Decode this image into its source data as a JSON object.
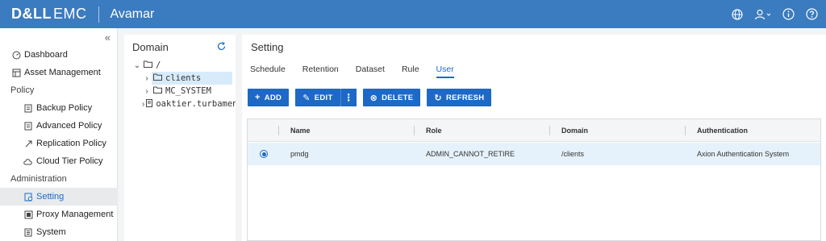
{
  "header": {
    "brand_bold": "D&LL",
    "brand_light": "EMC",
    "app_name": "Avamar"
  },
  "nav": {
    "collapse_glyph": "«",
    "items": [
      {
        "label": "Dashboard",
        "icon": "dashboard-icon"
      },
      {
        "label": "Asset Management",
        "icon": "asset-icon"
      },
      {
        "label": "Policy",
        "section": true
      },
      {
        "label": "Backup Policy",
        "icon": "policy-icon"
      },
      {
        "label": "Advanced Policy",
        "icon": "policy-icon"
      },
      {
        "label": "Replication Policy",
        "icon": "replication-icon"
      },
      {
        "label": "Cloud Tier Policy",
        "icon": "cloud-icon"
      },
      {
        "label": "Administration",
        "section": true
      },
      {
        "label": "Setting",
        "icon": "setting-icon",
        "active": true
      },
      {
        "label": "Proxy Management",
        "icon": "proxy-icon"
      },
      {
        "label": "System",
        "icon": "system-icon"
      }
    ]
  },
  "domain": {
    "title": "Domain",
    "tree": [
      {
        "label": "/",
        "expanded": true
      },
      {
        "label": "clients",
        "selected": true
      },
      {
        "label": "MC_SYSTEM"
      },
      {
        "label": "oaktier.turbamen"
      }
    ]
  },
  "main": {
    "title": "Setting",
    "tabs": [
      "Schedule",
      "Retention",
      "Dataset",
      "Rule",
      "User"
    ],
    "active_tab": "User",
    "buttons": {
      "add": "ADD",
      "edit": "EDIT",
      "delete": "DELETE",
      "refresh": "REFRESH"
    },
    "columns": [
      "Name",
      "Role",
      "Domain",
      "Authentication"
    ],
    "rows": [
      {
        "name": "pmdg",
        "role": "ADMIN_CANNOT_RETIRE",
        "domain": "/clients",
        "authentication": "Axion Authentication System",
        "selected": true
      }
    ]
  },
  "colors": {
    "header_bg": "#3b7bbf",
    "accent": "#1d69c5",
    "selected_row": "#e6f2fb"
  }
}
